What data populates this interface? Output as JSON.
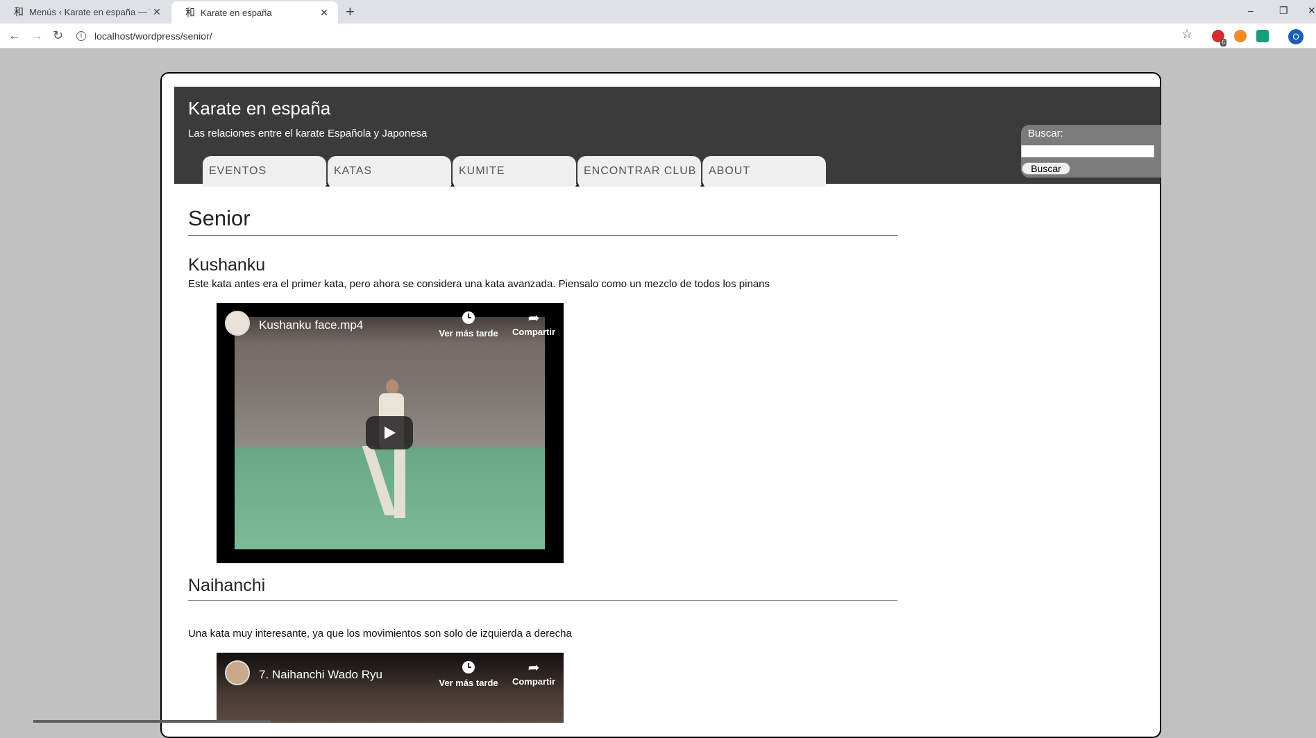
{
  "browser": {
    "tabs": [
      {
        "favicon": "和",
        "title": "Menús ‹ Karate en españa — Wo",
        "active": false
      },
      {
        "favicon": "和",
        "title": "Karate en españa",
        "active": true
      }
    ],
    "new_tab_label": "+",
    "window_controls": {
      "minimize": "–",
      "restore": "❐",
      "close": "✕"
    },
    "nav": {
      "back": "←",
      "forward": "→",
      "reload": "↻"
    },
    "url": "localhost/wordpress/senior/",
    "info_glyph": "i",
    "bookmark_glyph": "☆",
    "extension_badge": "6",
    "profile_initial": "O"
  },
  "site": {
    "title": "Karate en españa",
    "description": "Las relaciones entre el karate Española y Japonesa"
  },
  "menu": {
    "items": [
      "EVENTOS",
      "KATAS",
      "KUMITE",
      "ENCONTRAR CLUB",
      "ABOUT"
    ]
  },
  "search": {
    "label": "Buscar:",
    "input_value": "",
    "button_label": "Buscar"
  },
  "page": {
    "title": "Senior",
    "sections": [
      {
        "title": "Kushanku",
        "description": "Este kata antes era el primer kata, pero ahora se considera una kata avanzada. Piensalo como un mezclo de todos los pinans",
        "video": {
          "title": "Kushanku face.mp4",
          "watch_later": "Ver más tarde",
          "share": "Compartir"
        }
      },
      {
        "title": "Naihanchi",
        "description": "Una kata muy interesante, ya que los movimientos son solo de izquierda a derecha",
        "video": {
          "title": "7. Naihanchi Wado Ryu",
          "watch_later": "Ver más tarde",
          "share": "Compartir"
        }
      }
    ]
  },
  "colors": {
    "page_background": "#c1c1c1",
    "header_background": "#3c3b3b",
    "menu_tab": "#efefef",
    "search_panel": "#7b7b7b"
  }
}
